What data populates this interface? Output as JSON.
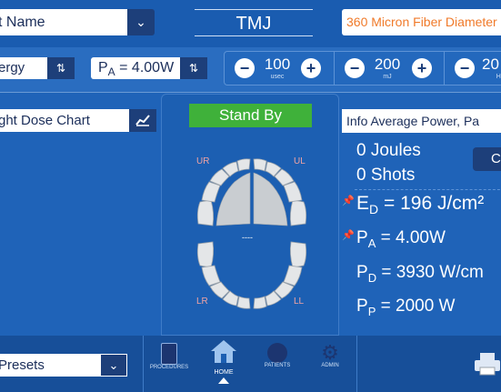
{
  "header": {
    "patient_name": "t Name",
    "title": "TMJ",
    "fiber": "360 Micron Fiber Diameter"
  },
  "toolbar": {
    "mode": "ergy",
    "pa_label": "P",
    "pa_sub": "A",
    "pa_value": "= 4.00W",
    "controls": [
      {
        "value": "100",
        "unit": "usec"
      },
      {
        "value": "200",
        "unit": "mJ"
      },
      {
        "value": "20",
        "unit": "Hz"
      }
    ],
    "minus": "−",
    "plus": "+"
  },
  "left": {
    "chart_select": "ght Dose Chart",
    "presets": "Presets"
  },
  "center": {
    "status": "Stand By",
    "quadrants": {
      "ur": "UR",
      "ul": "UL",
      "lr": "LR",
      "ll": "LL"
    },
    "midline": "----"
  },
  "right": {
    "info_select": "Info Average Power, Pa",
    "joules": "0 Joules",
    "shots": "0 Shots",
    "c_button": "C",
    "ed_label": "E",
    "ed_sub": "D",
    "ed_value": "= 196 J/cm²",
    "pa_label": "P",
    "pa_sub": "A",
    "pa_value": "= 4.00W",
    "pd_label": "P",
    "pd_sub": "D",
    "pd_value": "= 3930 W/cm",
    "pp_label": "P",
    "pp_sub": "P",
    "pp_value": "= 2000 W"
  },
  "nav": {
    "items": [
      {
        "label": "PROCEDURES",
        "icon": "clipboard-icon"
      },
      {
        "label": "HOME",
        "icon": "home-icon"
      },
      {
        "label": "PATIENTS",
        "icon": "people-icon"
      },
      {
        "label": "ADMIN",
        "icon": "gear-icon"
      }
    ]
  },
  "colors": {
    "accent": "#1f63b8",
    "standby": "#3fb13a",
    "fiber_text": "#f07a2a"
  }
}
